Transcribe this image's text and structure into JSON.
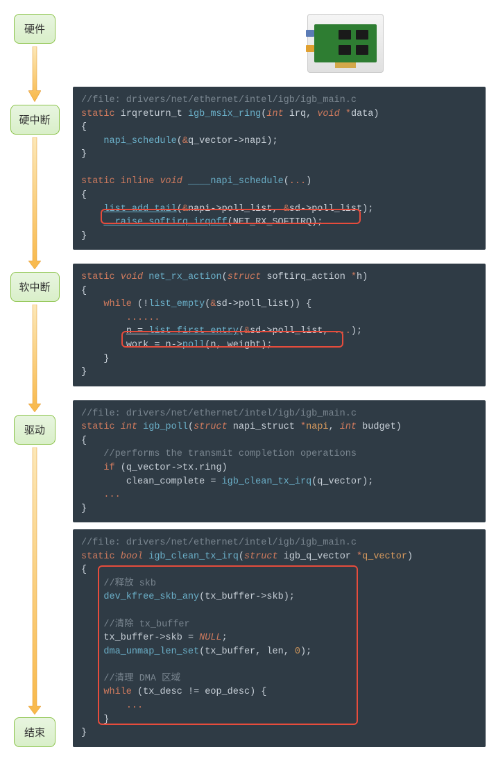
{
  "stages": {
    "hardware": "硬件",
    "hard_interrupt": "硬中断",
    "soft_interrupt": "软中断",
    "driver": "驱动",
    "end": "结束"
  },
  "code_blocks": {
    "block1": {
      "file_comment": "//file: drivers/net/ethernet/intel/igb/igb_main.c",
      "tokens": {
        "static": "static",
        "irqreturn_t": "irqreturn_t",
        "igb_msix_ring": "igb_msix_ring",
        "int": "int",
        "irq": "irq",
        "void": "void",
        "data": "data",
        "napi_schedule": "napi_schedule",
        "q_vector": "q_vector",
        "napi": "napi",
        "inline": "inline",
        "napi_schedule_fn": "____napi_schedule",
        "ellipsis": "...",
        "list_add_tail": "list_add_tail",
        "poll_list": "poll_list",
        "sd": "sd",
        "raise_softirq": "__raise_softirq_irqoff",
        "net_rx_softirq": "NET_RX_SOFTIRQ"
      }
    },
    "block2": {
      "tokens": {
        "static": "static",
        "void": "void",
        "net_rx_action": "net_rx_action",
        "struct": "struct",
        "softirq_action": "softirq_action",
        "h": "h",
        "while": "while",
        "list_empty": "list_empty",
        "sd": "sd",
        "poll_list": "poll_list",
        "dots": "......",
        "n": "n",
        "list_first_entry": "list_first_entry",
        "ellipsis": "...",
        "work": "work",
        "poll": "poll",
        "weight": "weight"
      }
    },
    "block3": {
      "file_comment": "//file: drivers/net/ethernet/intel/igb/igb_main.c",
      "tokens": {
        "static": "static",
        "int": "int",
        "igb_poll": "igb_poll",
        "struct": "struct",
        "napi_struct": "napi_struct",
        "napi": "napi",
        "budget": "budget",
        "comment": "//performs the transmit completion operations",
        "if": "if",
        "q_vector": "q_vector",
        "tx": "tx",
        "ring": "ring",
        "clean_complete": "clean_complete",
        "igb_clean_tx_irq": "igb_clean_tx_irq",
        "ellipsis": "..."
      }
    },
    "block4": {
      "file_comment": "//file: drivers/net/ethernet/intel/igb/igb_main.c",
      "tokens": {
        "static": "static",
        "bool": "bool",
        "igb_clean_tx_irq": "igb_clean_tx_irq",
        "struct": "struct",
        "igb_q_vector": "igb_q_vector",
        "q_vector": "q_vector",
        "comment_skb": "//释放 skb",
        "dev_kfree_skb_any": "dev_kfree_skb_any",
        "tx_buffer": "tx_buffer",
        "skb": "skb",
        "comment_tx_buffer": "//清除 tx_buffer",
        "null": "NULL",
        "dma_unmap_len_set": "dma_unmap_len_set",
        "len": "len",
        "zero": "0",
        "comment_dma": "//清理 DMA 区域",
        "while": "while",
        "tx_desc": "tx_desc",
        "eop_desc": "eop_desc",
        "ellipsis": "..."
      }
    }
  }
}
